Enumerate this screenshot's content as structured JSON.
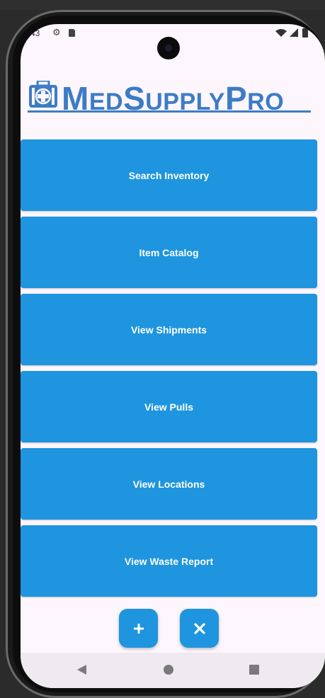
{
  "status_bar": {
    "time": "43"
  },
  "app": {
    "logo": {
      "first_cap": "M",
      "first_rest": "ED",
      "second_cap": "S",
      "second_rest": "UPPLY",
      "third_cap": "P",
      "third_rest": "RO"
    },
    "brand_color": "#3d7cc6"
  },
  "menu": {
    "accent_color": "#1e95de",
    "items": [
      {
        "label": "Search Inventory"
      },
      {
        "label": "Item Catalog"
      },
      {
        "label": "View Shipments"
      },
      {
        "label": "View Pulls"
      },
      {
        "label": "View Locations"
      },
      {
        "label": "View Waste Report"
      }
    ]
  },
  "fabs": {
    "add_icon": "plus-icon",
    "close_icon": "close-icon"
  },
  "nav_bar": {
    "icons": [
      "back-icon",
      "home-icon",
      "recents-icon"
    ]
  }
}
